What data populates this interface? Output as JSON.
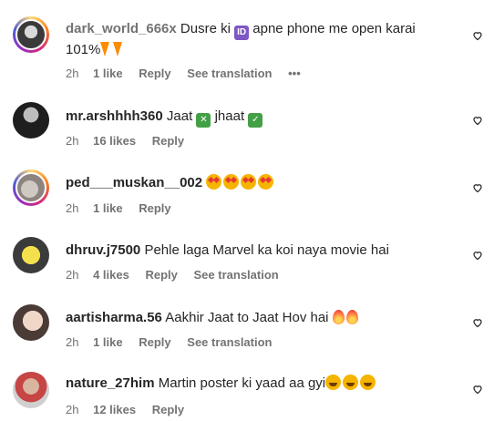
{
  "comments": [
    {
      "username": "dark_world_666x",
      "text_before": "Dusre ki",
      "text_after": "apne phone me open karai",
      "text_line2": "101%",
      "inline_badge": "ID",
      "emojis": [
        "carrot",
        "carrot"
      ],
      "time": "2h",
      "likes": "1 like",
      "reply": "Reply",
      "translation": "See translation",
      "more": "•••"
    },
    {
      "username": "mr.arshhhh360",
      "text_a": "Jaat",
      "badge_x": "✕",
      "text_b": "jhaat",
      "badge_check": "✓",
      "time": "2h",
      "likes": "16 likes",
      "reply": "Reply"
    },
    {
      "username": "ped___muskan__002",
      "emojis": [
        "star-struck",
        "star-struck",
        "star-struck",
        "star-struck"
      ],
      "time": "2h",
      "likes": "1 like",
      "reply": "Reply"
    },
    {
      "username": "dhruv.j7500",
      "text": "Pehle laga Marvel ka koi naya movie hai",
      "time": "2h",
      "likes": "4 likes",
      "reply": "Reply",
      "translation": "See translation"
    },
    {
      "username": "aartisharma.56",
      "text": "Aakhir Jaat to Jaat Hov hai",
      "emojis": [
        "fire",
        "fire"
      ],
      "time": "2h",
      "likes": "1 like",
      "reply": "Reply",
      "translation": "See translation"
    },
    {
      "username": "nature_27him",
      "text": "Martin poster ki yaad aa gyi",
      "emojis": [
        "laughing",
        "laughing",
        "laughing"
      ],
      "time": "2h",
      "likes": "12 likes",
      "reply": "Reply"
    }
  ],
  "colors": {
    "text": "#262626",
    "muted": "#737373",
    "story_ring": "#d62976"
  },
  "icons": {
    "like": "heart-outline-icon"
  }
}
